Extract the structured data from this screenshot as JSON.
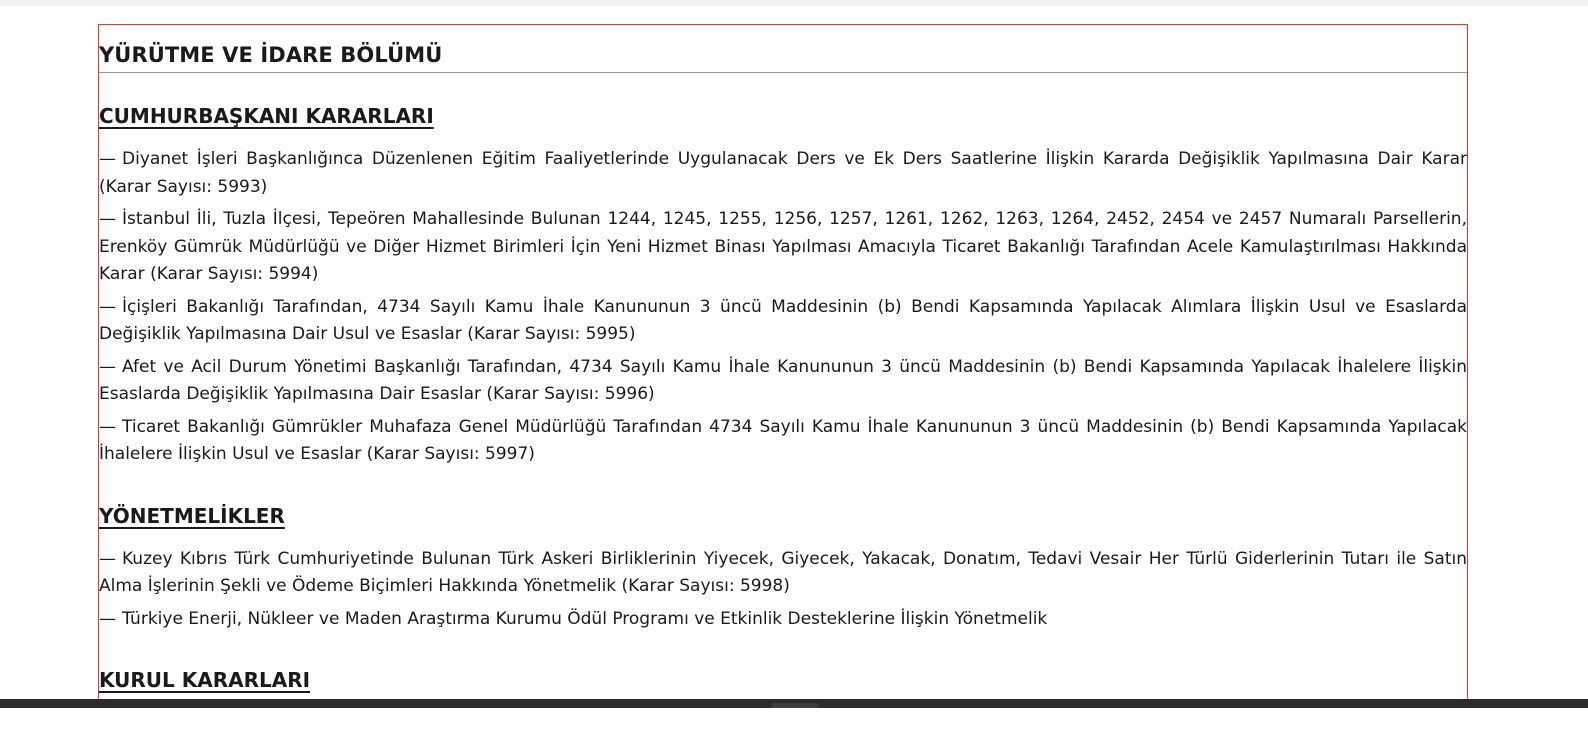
{
  "section_title": "YÜRÜTME VE İDARE BÖLÜMÜ",
  "dash": "—",
  "groups": [
    {
      "title": "CUMHURBAŞKANI KARARLARI",
      "items": [
        "Diyanet İşleri Başkanlığınca Düzenlenen Eğitim Faaliyetlerinde Uygulanacak Ders ve Ek Ders Saatlerine İlişkin Kararda Değişiklik Yapılmasına Dair Karar (Karar Sayısı: 5993)",
        "İstanbul İli, Tuzla İlçesi, Tepeören Mahallesinde Bulunan 1244, 1245, 1255, 1256, 1257, 1261, 1262, 1263, 1264, 2452, 2454 ve 2457 Numaralı Parsellerin, Erenköy Gümrük Müdürlüğü ve Diğer Hizmet Birimleri İçin Yeni Hizmet Binası Yapılması Amacıyla Ticaret Bakanlığı Tarafından Acele Kamulaştırılması Hakkında Karar (Karar Sayısı: 5994)",
        "İçişleri Bakanlığı Tarafından, 4734 Sayılı Kamu İhale Kanununun 3 üncü Maddesinin (b) Bendi Kapsamında Yapılacak Alımlara İlişkin Usul ve Esaslarda Değişiklik Yapılmasına Dair Usul ve Esaslar (Karar Sayısı: 5995)",
        "Afet ve Acil Durum Yönetimi Başkanlığı Tarafından, 4734 Sayılı Kamu İhale Kanununun 3 üncü Maddesinin (b) Bendi Kapsamında Yapılacak İhalelere İlişkin Esaslarda Değişiklik Yapılmasına Dair Esaslar (Karar Sayısı: 5996)",
        "Ticaret Bakanlığı Gümrükler Muhafaza Genel Müdürlüğü Tarafından 4734 Sayılı Kamu İhale Kanununun 3 üncü Maddesinin (b) Bendi Kapsamında Yapılacak İhalelere İlişkin Usul ve Esaslar (Karar Sayısı: 5997)"
      ]
    },
    {
      "title": "YÖNETMELİKLER",
      "items": [
        "Kuzey Kıbrıs Türk Cumhuriyetinde Bulunan Türk Askeri Birliklerinin Yiyecek, Giyecek, Yakacak, Donatım, Tedavi Vesair Her Türlü Giderlerinin Tutarı ile Satın Alma İşlerinin Şekli ve Ödeme Biçimleri Hakkında Yönetmelik (Karar Sayısı: 5998)",
        "Türkiye Enerji, Nükleer ve Maden Araştırma Kurumu Ödül Programı ve Etkinlik Desteklerine İlişkin Yönetmelik"
      ]
    },
    {
      "title": "KURUL KARARLARI",
      "items": []
    }
  ],
  "colors": {
    "frame_border": "#ff2a2a",
    "text": "#1a1a1a",
    "divider": "#9a9a9a",
    "bottom_bar": "#2b2b2b"
  }
}
